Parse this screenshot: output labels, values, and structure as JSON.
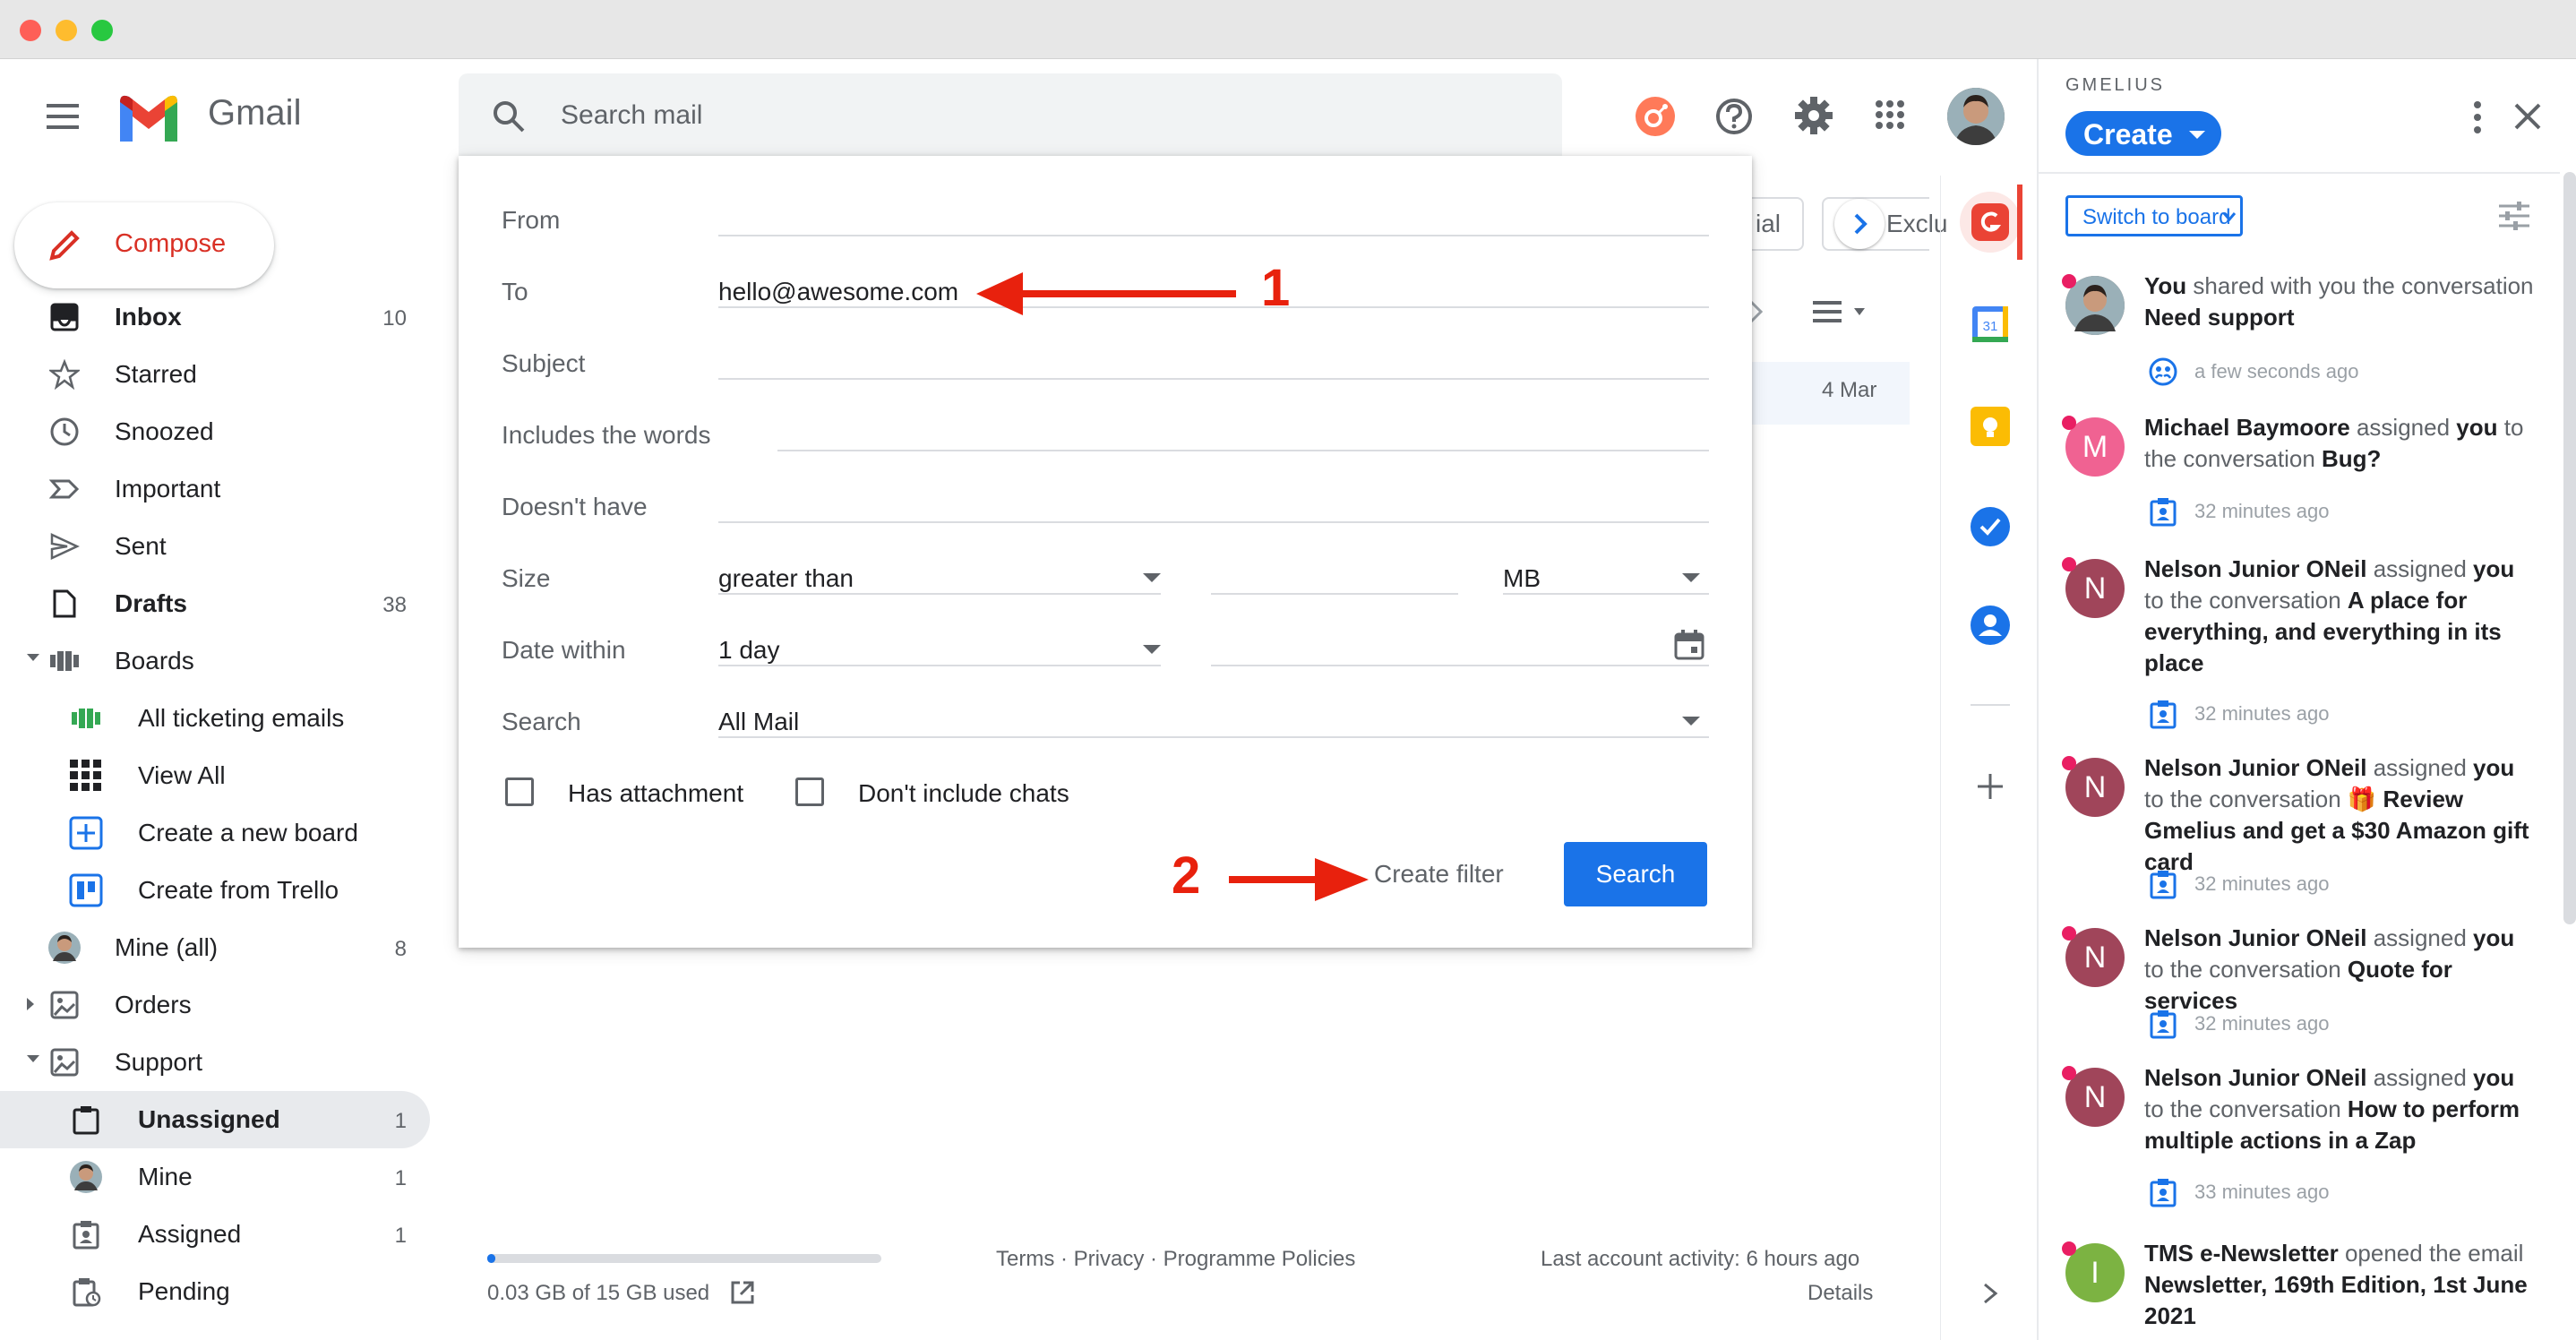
{
  "app": {
    "name": "Gmail"
  },
  "search": {
    "placeholder": "Search mail"
  },
  "compose": {
    "label": "Compose"
  },
  "nav": [
    {
      "label": "Inbox",
      "count": "10",
      "bold": true
    },
    {
      "label": "Starred",
      "count": ""
    },
    {
      "label": "Snoozed",
      "count": ""
    },
    {
      "label": "Important",
      "count": ""
    },
    {
      "label": "Sent",
      "count": ""
    },
    {
      "label": "Drafts",
      "count": "38",
      "bold": true
    },
    {
      "label": "Boards",
      "count": ""
    },
    {
      "label": "All ticketing emails",
      "count": ""
    },
    {
      "label": "View All",
      "count": ""
    },
    {
      "label": "Create a new board",
      "count": ""
    },
    {
      "label": "Create from Trello",
      "count": ""
    },
    {
      "label": "Mine (all)",
      "count": "8"
    },
    {
      "label": "Orders",
      "count": ""
    },
    {
      "label": "Support",
      "count": ""
    },
    {
      "label": "Unassigned",
      "count": "1",
      "bold": true
    },
    {
      "label": "Mine",
      "count": "1"
    },
    {
      "label": "Assigned",
      "count": "1"
    },
    {
      "label": "Pending",
      "count": ""
    }
  ],
  "filter": {
    "from_label": "From",
    "to_label": "To",
    "to_value": "hello@awesome.com",
    "subject_label": "Subject",
    "includes_label": "Includes the words",
    "doesnt_have_label": "Doesn't have",
    "size_label": "Size",
    "size_operator": "greater than",
    "size_unit": "MB",
    "date_label": "Date within",
    "date_value": "1 day",
    "search_label": "Search",
    "search_scope": "All Mail",
    "has_attachment": "Has attachment",
    "no_chats": "Don't include chats",
    "create_filter": "Create filter",
    "search_button": "Search"
  },
  "annotations": {
    "step1": "1",
    "step2": "2"
  },
  "mail_area": {
    "tab_partial_1": "ial",
    "tab_partial_2": "Exclu",
    "row_date": "4 Mar"
  },
  "footer": {
    "storage": "0.03 GB of 15 GB used",
    "storage_fraction": 0.002,
    "links": "Terms · Privacy · Programme Policies",
    "activity": "Last account activity: 6 hours ago",
    "details": "Details"
  },
  "panel": {
    "brand": "GMELIUS",
    "create": "Create",
    "switch": "Switch to board",
    "feed": [
      {
        "initial": "",
        "color": "#8d6e63",
        "actor": "You",
        "action": " shared with you the conversation ",
        "target": "Need support",
        "time": "a few seconds ago"
      },
      {
        "initial": "M",
        "color": "#f06292",
        "actor": "Michael Baymoore",
        "action": " assigned ",
        "you": "you",
        "tail": " to the conversation ",
        "target": "Bug?",
        "time": "32 minutes ago"
      },
      {
        "initial": "N",
        "color": "#a0455a",
        "actor": "Nelson Junior ONeil",
        "action": " assigned ",
        "you": "you",
        "tail": " to the conversation ",
        "target": "A place for everything, and everything in its place",
        "time": "32 minutes ago"
      },
      {
        "initial": "N",
        "color": "#a0455a",
        "actor": "Nelson Junior ONeil",
        "action": " assigned ",
        "you": "you",
        "tail": " to the conversation ",
        "target": "🎁 Review Gmelius and get a $30 Amazon gift card",
        "time": "32 minutes ago"
      },
      {
        "initial": "N",
        "color": "#a0455a",
        "actor": "Nelson Junior ONeil",
        "action": " assigned ",
        "you": "you",
        "tail": " to the conversation ",
        "target": "Quote for services",
        "time": "32 minutes ago"
      },
      {
        "initial": "N",
        "color": "#a0455a",
        "actor": "Nelson Junior ONeil",
        "action": " assigned ",
        "you": "you",
        "tail": " to the conversation ",
        "target": "How to perform multiple actions in a Zap",
        "time": "33 minutes ago"
      },
      {
        "initial": "I",
        "color": "#7cb342",
        "actor": "TMS e-Newsletter",
        "action": " opened the email ",
        "target": "Newsletter, 169th Edition, 1st June 2021",
        "time": ""
      }
    ]
  },
  "colors": {
    "gmail_red": "#d93025",
    "blue": "#1a73e8",
    "arrow_red": "#e8210d",
    "gmelius_blue": "#1a73e8"
  }
}
